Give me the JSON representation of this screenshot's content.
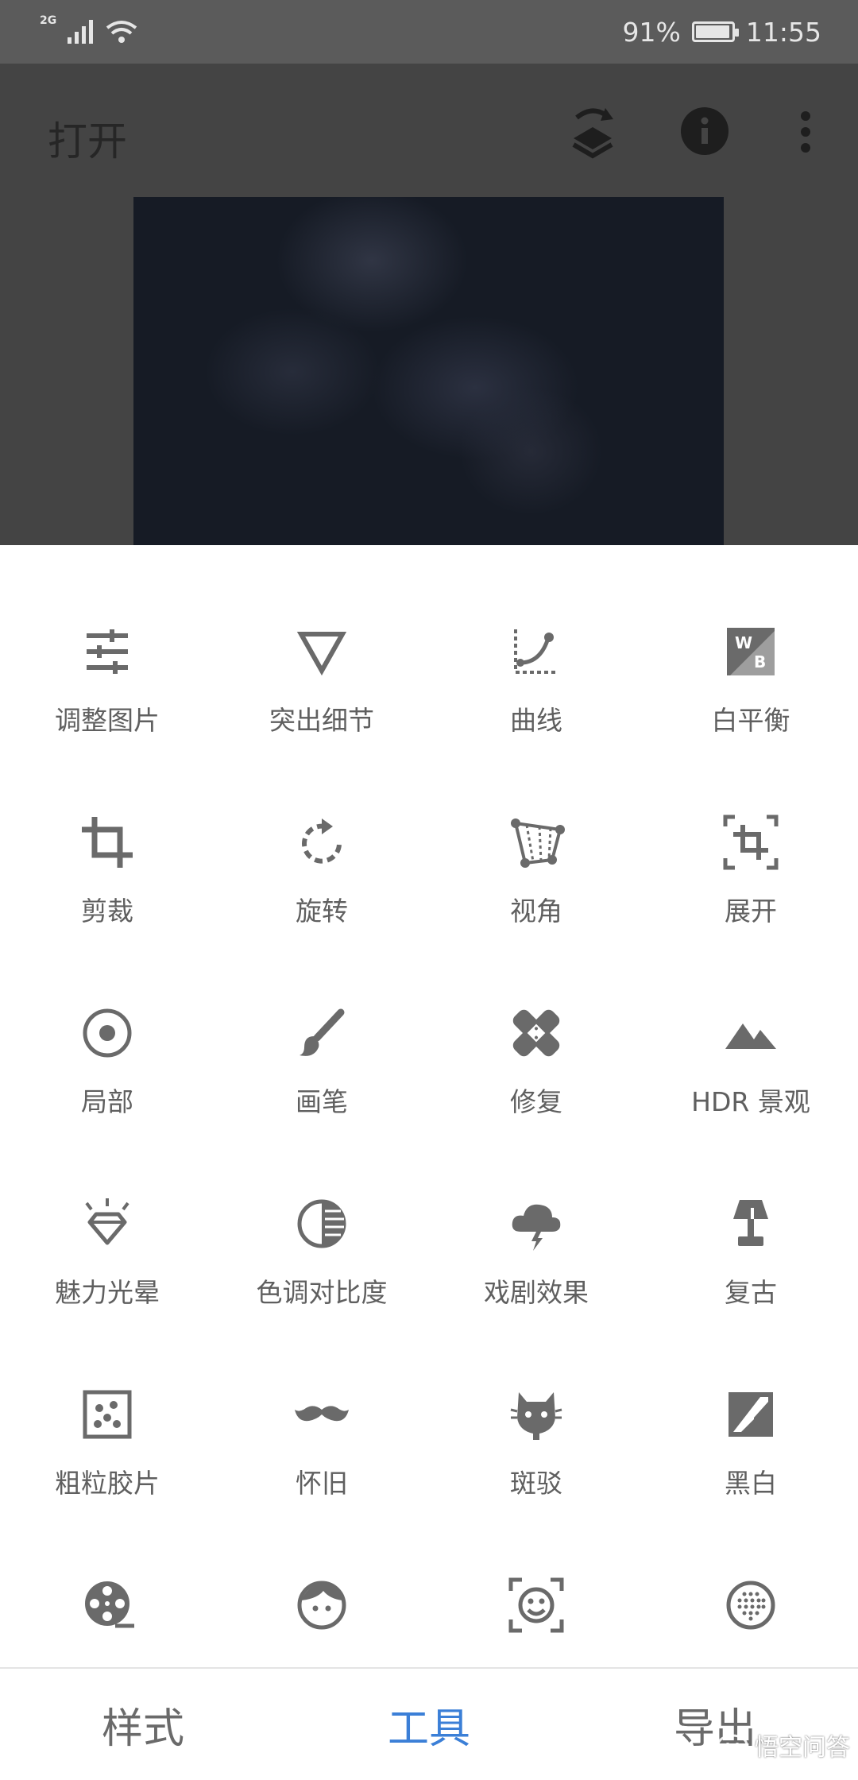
{
  "status_bar": {
    "network": "2G",
    "battery": "91%",
    "time": "11:55"
  },
  "header": {
    "title": "打开",
    "icons": [
      "layers-swap-icon",
      "info-icon",
      "more-vert-icon"
    ]
  },
  "tools": [
    {
      "label": "调整图片",
      "icon": "tune-sliders-icon"
    },
    {
      "label": "突出细节",
      "icon": "triangle-details-icon"
    },
    {
      "label": "曲线",
      "icon": "curves-icon"
    },
    {
      "label": "白平衡",
      "icon": "white-balance-icon"
    },
    {
      "label": "剪裁",
      "icon": "crop-icon"
    },
    {
      "label": "旋转",
      "icon": "rotate-icon"
    },
    {
      "label": "视角",
      "icon": "perspective-icon"
    },
    {
      "label": "展开",
      "icon": "expand-icon"
    },
    {
      "label": "局部",
      "icon": "selective-icon"
    },
    {
      "label": "画笔",
      "icon": "brush-icon"
    },
    {
      "label": "修复",
      "icon": "healing-icon"
    },
    {
      "label": "HDR 景观",
      "icon": "hdr-mountain-icon"
    },
    {
      "label": "魅力光晕",
      "icon": "glamour-glow-icon"
    },
    {
      "label": "色调对比度",
      "icon": "tonal-contrast-icon"
    },
    {
      "label": "戏剧效果",
      "icon": "drama-cloud-icon"
    },
    {
      "label": "复古",
      "icon": "vintage-lamp-icon"
    },
    {
      "label": "粗粒胶片",
      "icon": "grainy-film-icon"
    },
    {
      "label": "怀旧",
      "icon": "mustache-icon"
    },
    {
      "label": "斑驳",
      "icon": "grunge-icon"
    },
    {
      "label": "黑白",
      "icon": "black-white-icon"
    },
    {
      "label": "",
      "icon": "film-reel-icon"
    },
    {
      "label": "",
      "icon": "face-icon"
    },
    {
      "label": "",
      "icon": "face-detect-icon"
    },
    {
      "label": "",
      "icon": "dotted-circle-icon"
    }
  ],
  "bottom_nav": {
    "styles": "样式",
    "tools": "工具",
    "export": "导出",
    "active": "tools"
  },
  "watermark": "悟空问答",
  "colors": {
    "accent": "#3b7fd7",
    "icon": "#6a6a6a",
    "editor_bg": "#444444"
  }
}
